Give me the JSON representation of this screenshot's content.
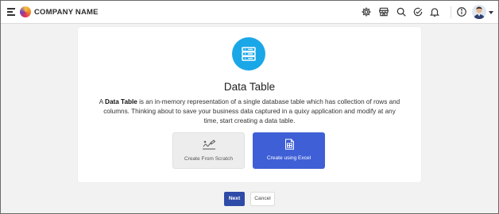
{
  "header": {
    "company_name": "COMPANY NAME",
    "icons": [
      "menu-icon",
      "gear-icon",
      "store-icon",
      "search-icon",
      "task-check-icon",
      "bell-icon",
      "info-icon",
      "avatar",
      "chevron-down-icon"
    ]
  },
  "card": {
    "icon": "server-icon",
    "title": "Data Table",
    "desc_prefix": "A ",
    "desc_bold": "Data Table",
    "desc_rest": " is an in-memory representation of a single database table which has collection of rows and columns. Thinking about to save your business data captured in a quixy application and modify at any time, start creating a data table.",
    "options": [
      {
        "label": "Create From Scratch",
        "icon": "sign-pen-icon",
        "selected": false
      },
      {
        "label": "Create using Excel",
        "icon": "excel-file-icon",
        "selected": true
      }
    ]
  },
  "footer": {
    "next_label": "Next",
    "cancel_label": "Cancel"
  },
  "colors": {
    "primary": "#3e5fd6",
    "next": "#2f4ba8",
    "icon_circle": "#1aa7e8",
    "background": "#f2f2f2"
  }
}
